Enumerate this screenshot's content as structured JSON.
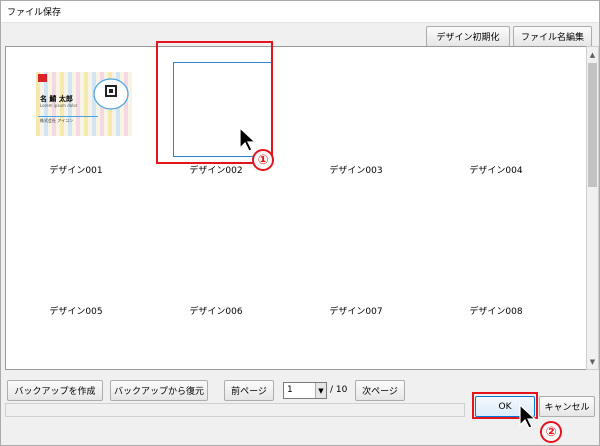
{
  "window": {
    "title": "ファイル保存"
  },
  "toolbar": {
    "reset_design_label": "デザイン初期化",
    "edit_filename_label": "ファイル名編集"
  },
  "grid": {
    "items": [
      {
        "label": "デザイン001",
        "has_thumbnail": true
      },
      {
        "label": "デザイン002",
        "has_thumbnail": false
      },
      {
        "label": "デザイン003",
        "has_thumbnail": false
      },
      {
        "label": "デザイン004",
        "has_thumbnail": false
      },
      {
        "label": "デザイン005",
        "has_thumbnail": false
      },
      {
        "label": "デザイン006",
        "has_thumbnail": false
      },
      {
        "label": "デザイン007",
        "has_thumbnail": false
      },
      {
        "label": "デザイン008",
        "has_thumbnail": false
      }
    ],
    "thumbnail_card": {
      "name_text": "名 鯖  太郎",
      "company_text": "株式会社 アイコン",
      "small_text": "Lorem ipsum dolor"
    }
  },
  "bottom": {
    "create_backup_label": "バックアップを作成",
    "restore_backup_label": "バックアップから復元",
    "prev_page_label": "前ページ",
    "page_value": "1",
    "page_total": "/ 10",
    "next_page_label": "次ページ",
    "ok_label": "OK",
    "cancel_label": "キャンセル"
  },
  "annotations": {
    "marker1": "①",
    "marker2": "②"
  },
  "colors": {
    "highlight": "#e3141e",
    "selection": "#2f82d2"
  }
}
